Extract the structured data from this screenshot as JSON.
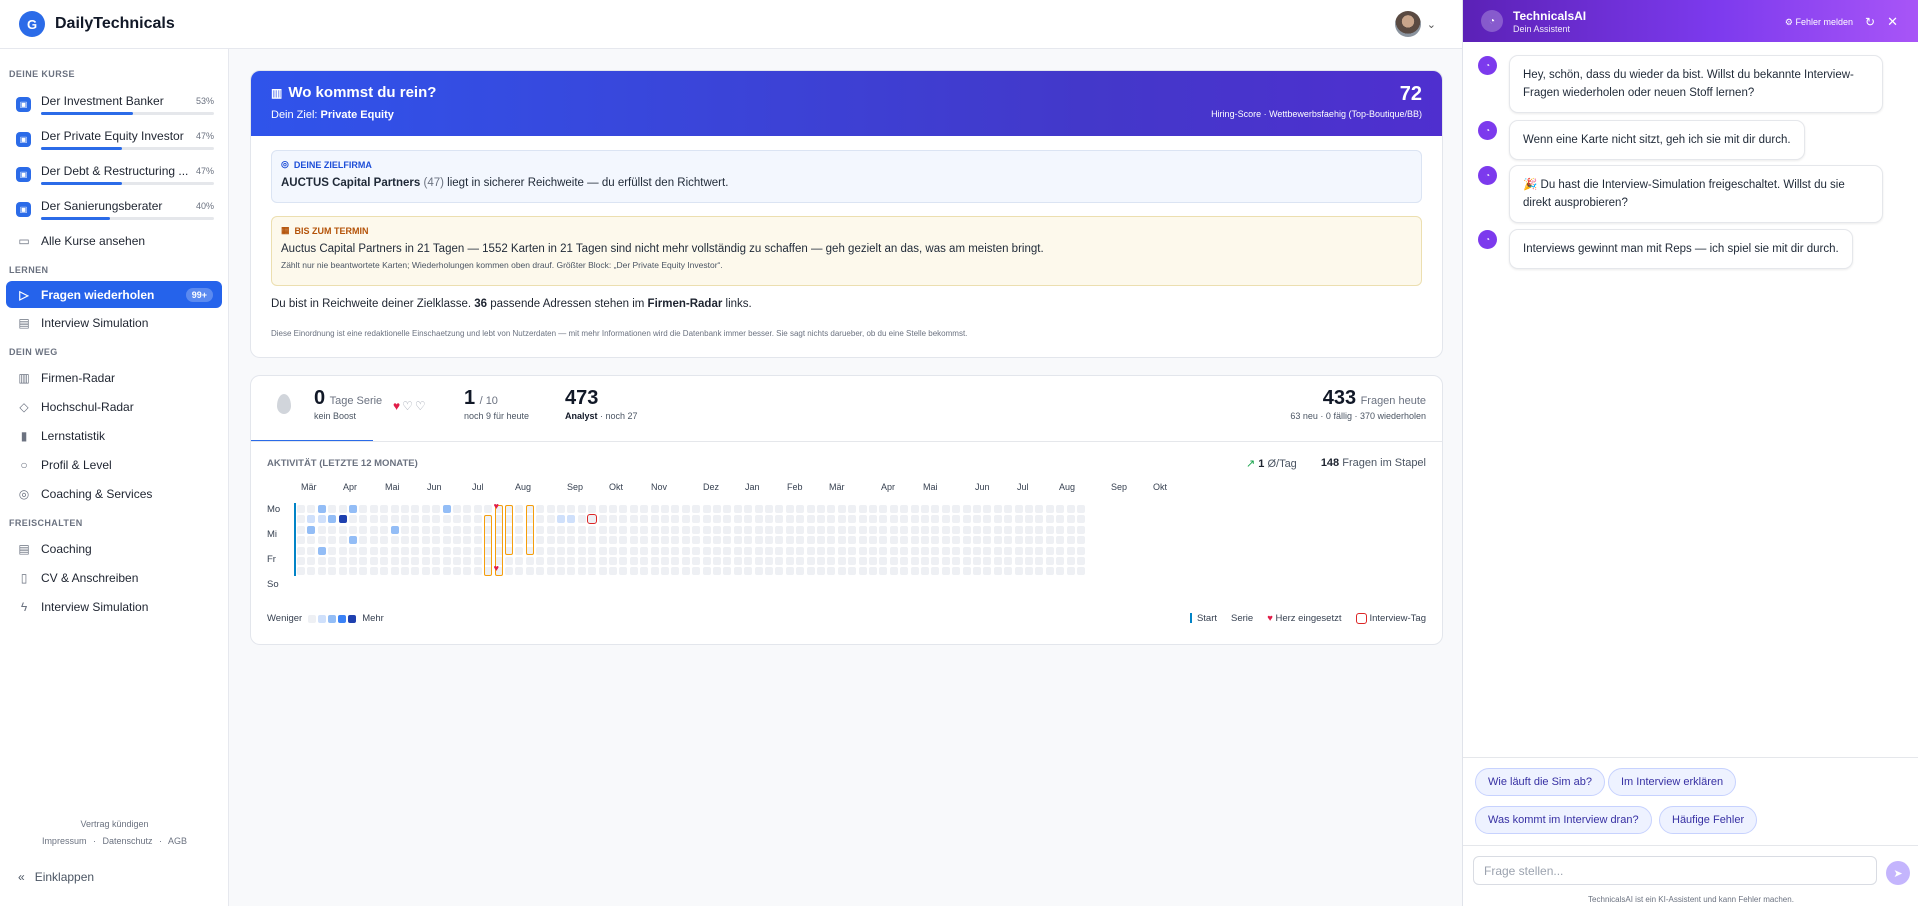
{
  "app": {
    "logo_letter": "G",
    "name": "DailyTechnicals"
  },
  "sidebar": {
    "sections": {
      "courses": "DEINE KURSE",
      "learn": "LERNEN",
      "path": "DEIN WEG",
      "unlock": "FREISCHALTEN"
    },
    "courses": [
      {
        "name": "Der Investment Banker",
        "percent": "53%",
        "progress": 0.53
      },
      {
        "name": "Der Private Equity Investor",
        "percent": "47%",
        "progress": 0.47
      },
      {
        "name": "Der Debt & Restructuring ...",
        "percent": "47%",
        "progress": 0.47
      },
      {
        "name": "Der Sanierungsberater",
        "percent": "40%",
        "progress": 0.4
      }
    ],
    "all_courses": "Alle Kurse ansehen",
    "learn": [
      {
        "label": "Fragen wiederholen",
        "badge": "99+",
        "icon": "play-icon"
      },
      {
        "label": "Interview Simulation",
        "icon": "briefcase-icon"
      }
    ],
    "path": [
      {
        "label": "Firmen-Radar",
        "icon": "building-icon"
      },
      {
        "label": "Hochschul-Radar",
        "icon": "graduation-cap-icon"
      },
      {
        "label": "Lernstatistik",
        "icon": "bar-chart-icon"
      },
      {
        "label": "Profil & Level",
        "icon": "user-icon"
      },
      {
        "label": "Coaching & Services",
        "icon": "lifebuoy-icon"
      }
    ],
    "unlock": [
      {
        "label": "Coaching",
        "icon": "briefcase-icon"
      },
      {
        "label": "CV & Anschreiben",
        "icon": "document-icon"
      },
      {
        "label": "Interview Simulation",
        "icon": "lightning-icon"
      }
    ],
    "footer": {
      "cancel": "Vertrag kündigen",
      "imprint": "Impressum",
      "privacy": "Datenschutz",
      "terms": "AGB",
      "sep": "·",
      "collapse": "Einklappen"
    }
  },
  "hero": {
    "title": "Wo kommst du rein?",
    "goal_prefix": "Dein Ziel:",
    "goal": "Private Equity",
    "score": "72",
    "score_label": "Hiring-Score · Wettbewerbsfaehig (Top-Boutique/BB)"
  },
  "target": {
    "heading": "DEINE ZIELFIRMA",
    "firm": "AUCTUS Capital Partners",
    "firm_count": "(47)",
    "text": "liegt in sicherer Reichweite — du erfüllst den Richtwert."
  },
  "deadline": {
    "heading": "BIS ZUM TERMIN",
    "text": "Auctus Capital Partners in 21 Tagen — 1552 Karten in 21 Tagen sind nicht mehr vollständig zu schaffen — geh gezielt an das, was am meisten bringt.",
    "sub": "Zählt nur nie beantwortete Karten; Wiederholungen kommen oben drauf. Größter Block: „Der Private Equity Investor“."
  },
  "reach": {
    "pre": "Du bist in Reichweite deiner Zielklasse.",
    "count": "36",
    "mid": "passende Adressen stehen im",
    "radar": "Firmen-Radar",
    "post": "links."
  },
  "note": "Diese Einordnung ist eine redaktionelle Einschaetzung und lebt von Nutzerdaten — mit mehr Informationen wird die Datenbank immer besser. Sie sagt nichts darueber, ob du eine Stelle bekommst.",
  "stats": {
    "streak": "0",
    "streak_label": "Tage Serie",
    "boost": "kein Boost",
    "hearts_filled": 1,
    "hearts_total": 3,
    "daily": "1",
    "daily_of": "/ 10",
    "daily_sub": "noch 9 für heute",
    "level": "473",
    "level_rank": "Analyst",
    "level_sub": "· noch 27",
    "today": "433",
    "today_label": "Fragen heute",
    "today_sub": "63 neu · 0 fällig · 370 wiederholen"
  },
  "activity": {
    "title": "AKTIVITÄT (LETZTE 12 MONATE)",
    "avg": "1",
    "avg_label": "Ø/Tag",
    "stack": "148",
    "stack_label": "Fragen im Stapel",
    "months": [
      "Mär",
      "Apr",
      "Mai",
      "Jun",
      "Jul",
      "Aug",
      "Sep",
      "Okt",
      "Nov",
      "Dez",
      "Jan",
      "Feb",
      "Mär",
      "Apr",
      "Mai",
      "Jun",
      "Jul",
      "Aug",
      "Sep",
      "Okt"
    ],
    "days": [
      "Mo",
      "Mi",
      "Fr",
      "So"
    ],
    "legend_less": "Weniger",
    "legend_more": "Mehr",
    "legend_start": "Start",
    "legend_streak": "Serie",
    "legend_heart": "Herz eingesetzt",
    "legend_interview": "Interview-Tag",
    "colors": {
      "empty": "#eef0f4",
      "l1": "#cfe0fb",
      "l2": "#93bdf6",
      "l3": "#3b82f6",
      "l4": "#1e40af",
      "streak": "#f59e0b",
      "heart": "#e11d48"
    }
  },
  "chat": {
    "title": "TechnicalsAI",
    "subtitle": "Dein Assistent",
    "report": "Fehler melden",
    "messages": [
      "Hey, schön, dass du wieder da bist. Willst du bekannte Interview-Fragen wiederholen oder neuen Stoff lernen?",
      "Wenn eine Karte nicht sitzt, geh ich sie mit dir durch.",
      "🎉 Du hast die Interview-Simulation freigeschaltet. Willst du sie direkt ausprobieren?",
      "Interviews gewinnt man mit Reps — ich spiel sie mit dir durch."
    ],
    "chips": [
      "Wie läuft die Sim ab?",
      "Im Interview erklären",
      "Was kommt im Interview dran?",
      "Häufige Fehler"
    ],
    "input_placeholder": "Frage stellen...",
    "disclaimer": "TechnicalsAI ist ein KI-Assistent und kann Fehler machen."
  }
}
